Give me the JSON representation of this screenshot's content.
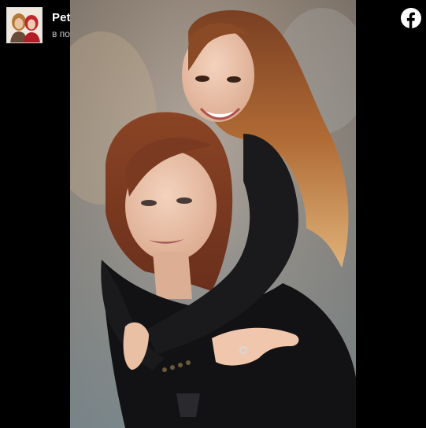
{
  "post": {
    "author_name": "Petya Dikova",
    "timestamp": "в понеделник",
    "avatar_alt": "Petya Dikova profile picture",
    "photo_alt": "Two women posing together, one hugging the other from behind",
    "network_icon": "facebook-logo-icon"
  },
  "colors": {
    "background": "#000000",
    "name_text": "#ffffff",
    "timestamp_text": "#c8c8c8",
    "icon_fill": "#ffffff"
  }
}
